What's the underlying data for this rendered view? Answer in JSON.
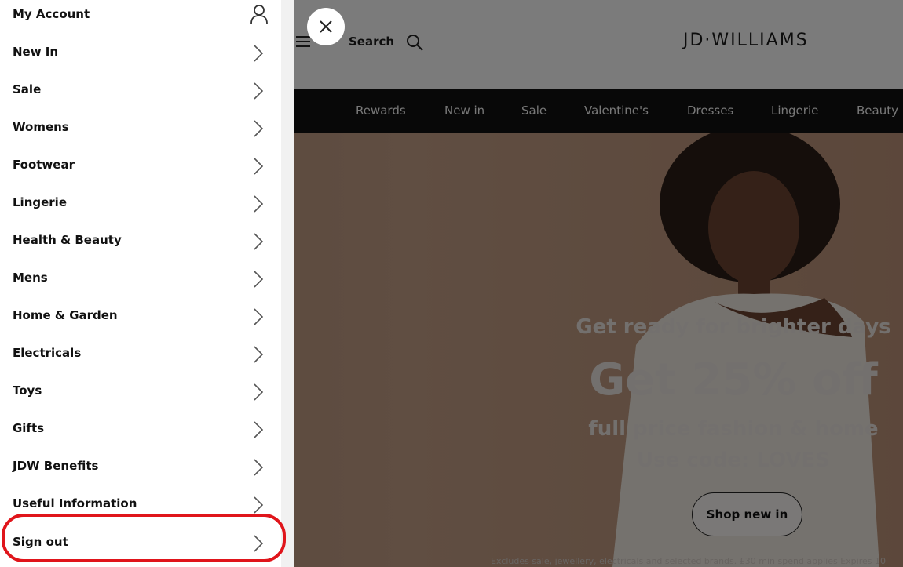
{
  "header": {
    "search_label": "Search",
    "logo": "JD·WILLIAMS"
  },
  "topnav": {
    "items": [
      "Rewards",
      "New in",
      "Sale",
      "Valentine's",
      "Dresses",
      "Lingerie",
      "Beauty"
    ]
  },
  "hero": {
    "headline_small": "Get ready for brighter days",
    "headline_big": "Get 25% off",
    "line1": "full price fashion & home",
    "line2": "Use code: LOVES",
    "cta": "Shop new in",
    "disclaimer": "Excludes sale, jewellery, electricals and selected brands. £30 min spend applies Expires 10"
  },
  "drawer": {
    "account_label": "My Account",
    "items": [
      "New In",
      "Sale",
      "Womens",
      "Footwear",
      "Lingerie",
      "Health & Beauty",
      "Mens",
      "Home & Garden",
      "Electricals",
      "Toys",
      "Gifts",
      "JDW Benefits",
      "Useful Information",
      "Sign out"
    ]
  },
  "colors": {
    "highlight": "#e0151b",
    "nav_bg": "#111111"
  }
}
